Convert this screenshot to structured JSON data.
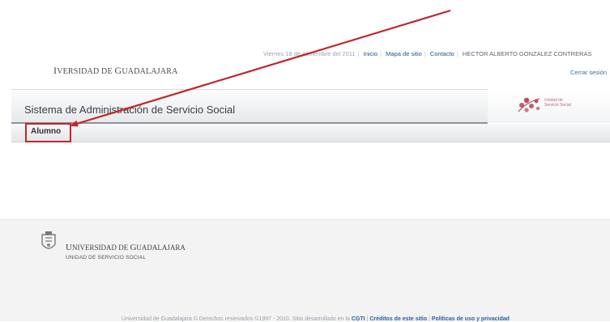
{
  "header": {
    "date_text": "Viernes 18 de noviembre del 2011",
    "links": [
      "Inicio",
      "Mapa de sitio",
      "Contacto"
    ],
    "user_name": "HECTOR ALBERTO GONZALEZ CONTRERAS",
    "logout": "Cerrar sesión",
    "university_name_cap1": "I",
    "university_name_rest1": "VERSIDAD DE ",
    "university_name_cap2": "G",
    "university_name_rest2": "UADALAJARA"
  },
  "title_bar": {
    "system_title": "Sistema de Administración de Servicio Social",
    "logo_text_line1": "Unidad de",
    "logo_text_line2": "Servicio Social"
  },
  "nav": {
    "items": [
      "Alumno"
    ]
  },
  "footer": {
    "university_cap1": "U",
    "university_rest1": "NIVERSIDAD DE ",
    "university_cap2": "G",
    "university_rest2": "UADALAJARA",
    "department": "UNIDAD DE SERVICIO SOCIAL",
    "legal_text": "Universidad de Guadalajara © Derechos reservados ©1997 - 2010. Sitio desarrollado en la",
    "link_cgti": "CGTI",
    "link_credits": "Créditos de este sitio",
    "link_policies": "Políticas de uso y privacidad"
  },
  "colors": {
    "annotation": "#c0262c",
    "link": "#1f4f8f"
  }
}
